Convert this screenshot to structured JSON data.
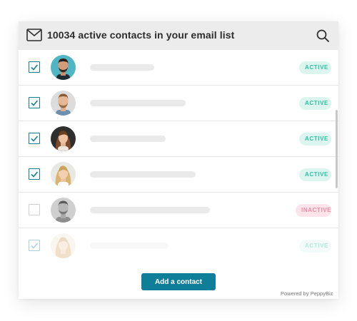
{
  "header": {
    "title": "10034 active contacts in your email list",
    "mail_icon": "envelope-icon",
    "search_icon": "magnifier-icon"
  },
  "contacts": [
    {
      "checked": true,
      "status": "ACTIVE",
      "avatar": "man-dark-beard"
    },
    {
      "checked": true,
      "status": "ACTIVE",
      "avatar": "man-light-beard"
    },
    {
      "checked": true,
      "status": "ACTIVE",
      "avatar": "woman-brown-hair"
    },
    {
      "checked": true,
      "status": "ACTIVE",
      "avatar": "woman-blonde-hair"
    },
    {
      "checked": false,
      "status": "INACTIVE",
      "avatar": "man-grayscale"
    },
    {
      "checked": true,
      "status": "ACTIVE",
      "avatar": "woman-blonde-faded"
    }
  ],
  "actions": {
    "add_contact_label": "Add a contact"
  },
  "footer": {
    "powered_by": "Powered by PeppyBiz"
  },
  "colors": {
    "accent": "#0f7e98",
    "active_text": "#2cc2a0",
    "active_bg": "#dcf6ef",
    "inactive_text": "#f08aa0",
    "inactive_bg": "#fde4ea"
  }
}
